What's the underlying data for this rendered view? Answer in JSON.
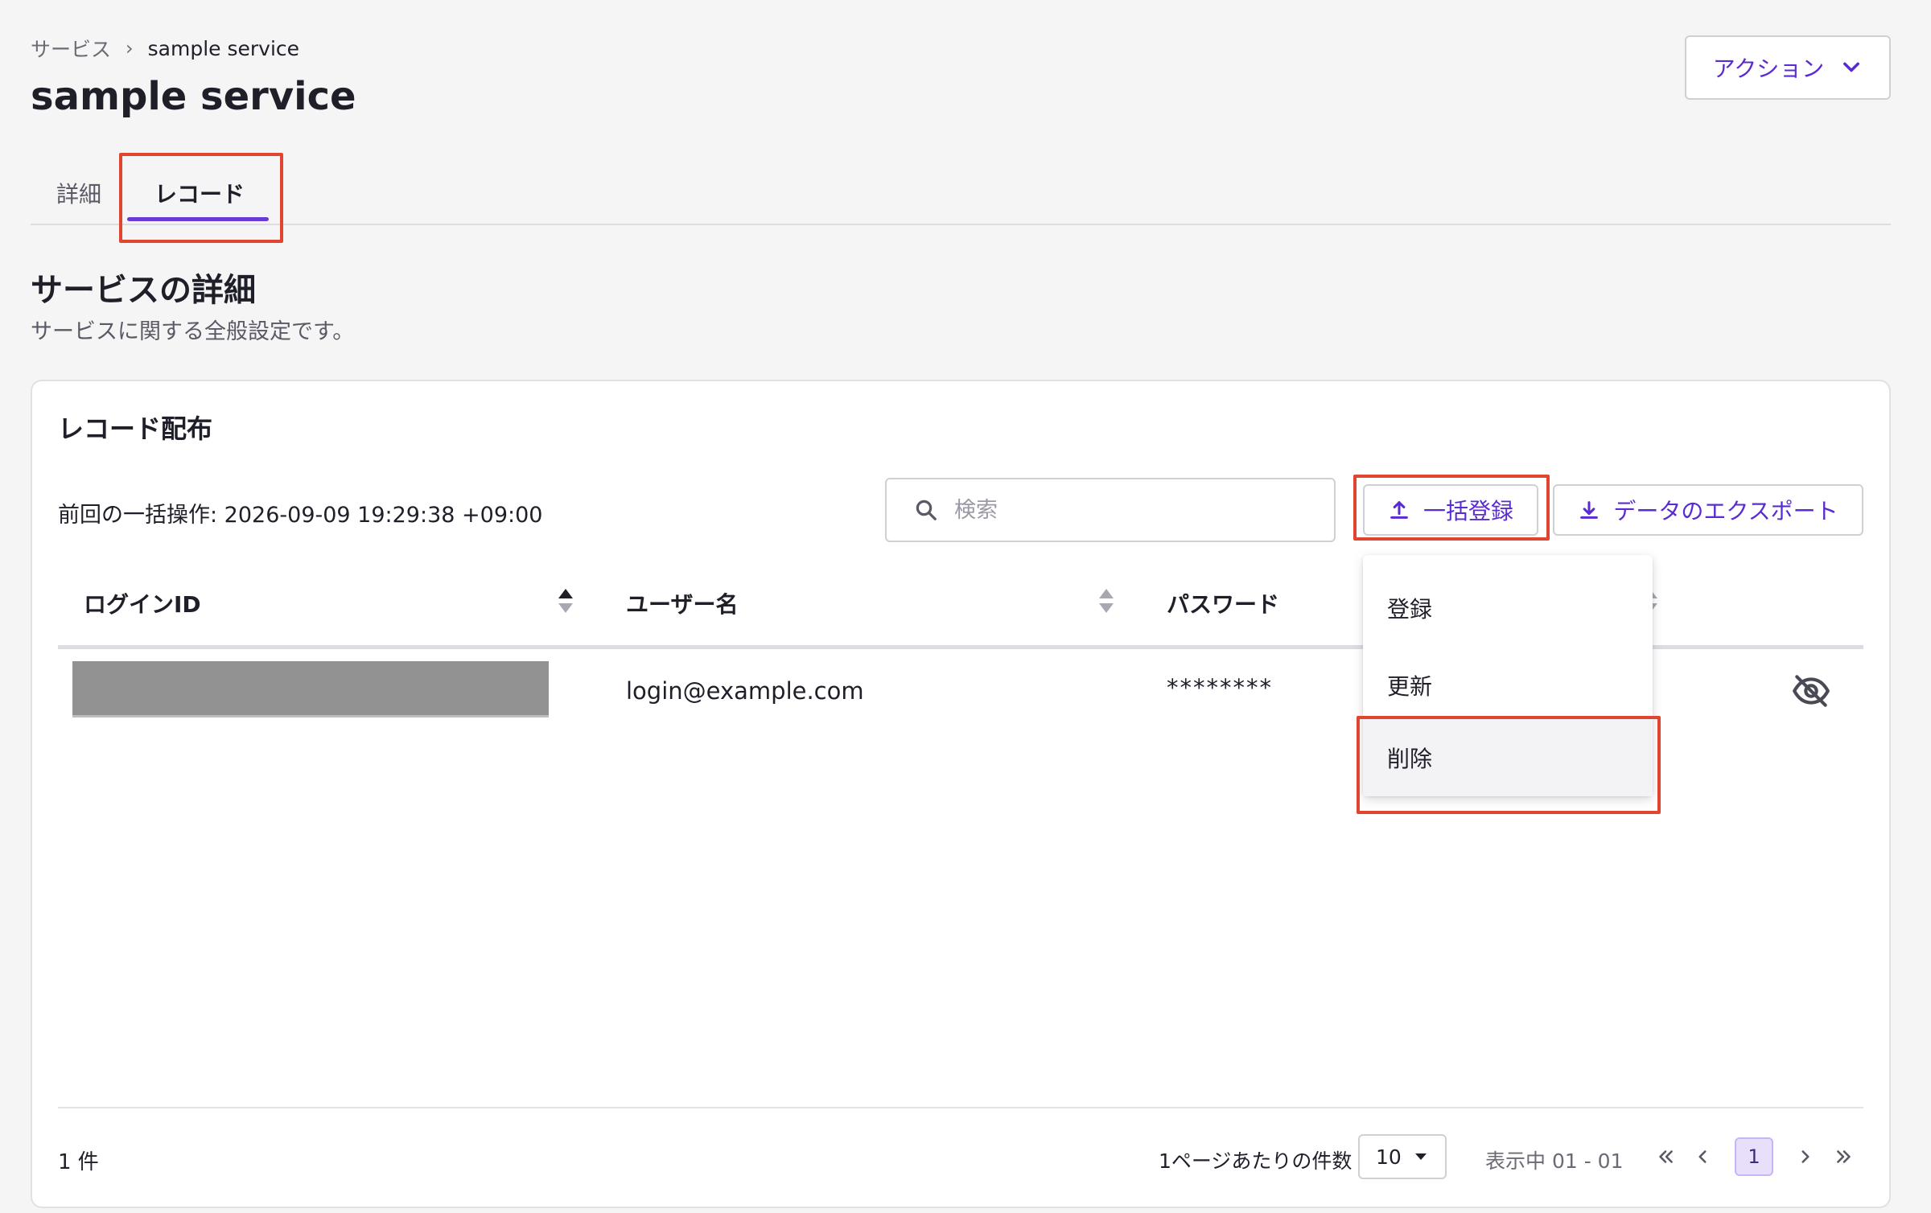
{
  "breadcrumb": {
    "root": "サービス",
    "separator": "›",
    "current": "sample service"
  },
  "page_title": "sample service",
  "actions": {
    "label": "アクション"
  },
  "tabs": [
    {
      "label": "詳細",
      "active": false
    },
    {
      "label": "レコード",
      "active": true
    }
  ],
  "section": {
    "title": "サービスの詳細",
    "description": "サービスに関する全般設定です。"
  },
  "card": {
    "title": "レコード配布",
    "last_operation": "前回の一括操作: 2026-09-09 19:29:38 +09:00",
    "search": {
      "placeholder": "検索",
      "value": ""
    },
    "bulk_button": "一括登録",
    "export_button": "データのエクスポート"
  },
  "table": {
    "columns": [
      "ログインID",
      "ユーザー名",
      "パスワード"
    ],
    "rows": [
      {
        "login_id": "",
        "username": "login@example.com",
        "password": "********"
      }
    ]
  },
  "bulk_menu": {
    "items": [
      "登録",
      "更新",
      "削除"
    ],
    "highlighted_index": 2
  },
  "footer": {
    "total": "1 件",
    "per_page_label": "1ページあたりの件数",
    "per_page_value": "10",
    "range": "表示中 01 - 01",
    "current_page": "1"
  },
  "colors": {
    "accent": "#6a3ad6",
    "link_text": "#5a2bd0",
    "highlight_box": "#e0452f",
    "redacted": "#929292"
  },
  "icons": {
    "action_dropdown": "chevron-down-icon",
    "search": "search-icon",
    "bulk": "upload-icon",
    "export": "download-icon",
    "visibility": "eye-off-icon",
    "sort": "sort-icon"
  }
}
